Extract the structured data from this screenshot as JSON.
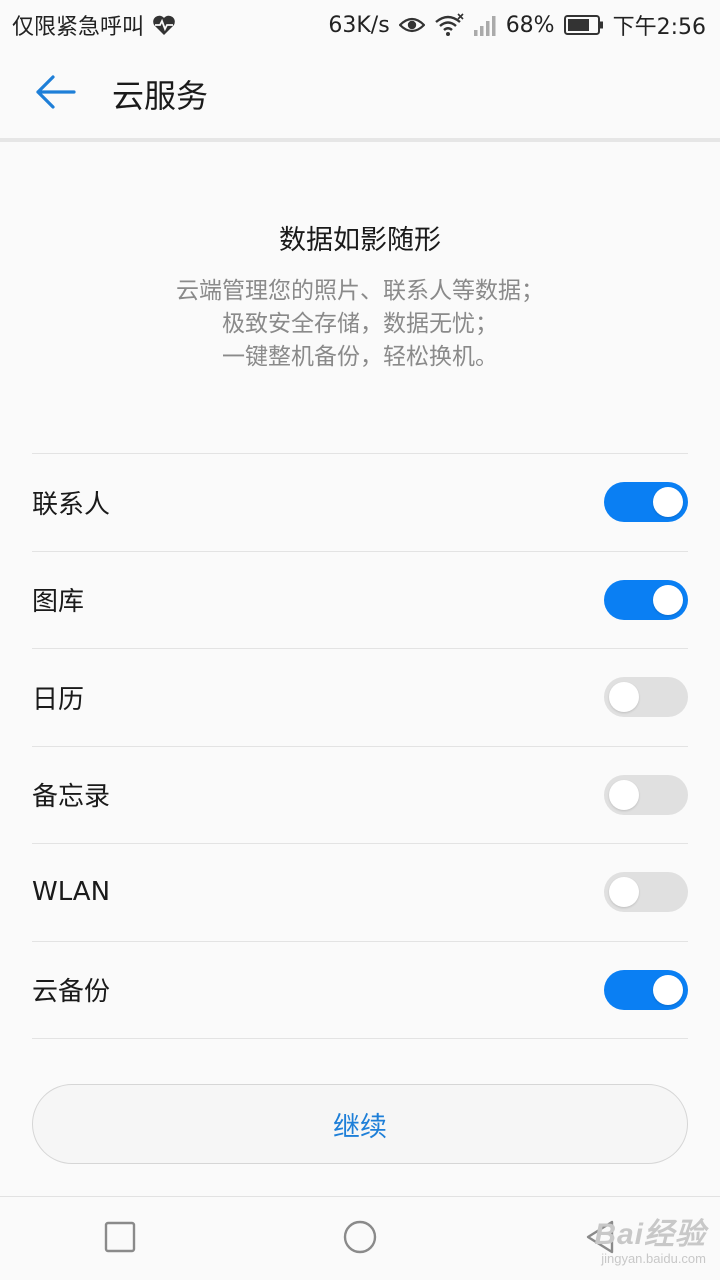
{
  "status_bar": {
    "carrier_text": "仅限紧急呼叫",
    "net_speed": "63K/s",
    "battery_percent": "68%",
    "time": "下午2:56",
    "icons": [
      "heart-rate-icon",
      "eye-icon",
      "wifi-icon",
      "signal-icon",
      "battery-icon"
    ]
  },
  "header": {
    "title": "云服务",
    "back_icon": "back-arrow-icon",
    "accent_color": "#1e7fd8"
  },
  "intro": {
    "heading": "数据如影随形",
    "lines": [
      "云端管理您的照片、联系人等数据；",
      "极致安全存储，数据无忧；",
      "一键整机备份，轻松换机。"
    ]
  },
  "sync_items": [
    {
      "label": "联系人",
      "enabled": true
    },
    {
      "label": "图库",
      "enabled": true
    },
    {
      "label": "日历",
      "enabled": false
    },
    {
      "label": "备忘录",
      "enabled": false
    },
    {
      "label": "WLAN",
      "enabled": false
    },
    {
      "label": "云备份",
      "enabled": true
    }
  ],
  "toggle_on_color": "#0a7ff3",
  "toggle_off_color": "#e0e0e0",
  "continue_button": {
    "label": "继续"
  },
  "nav_bar": {
    "icons": [
      "recent-apps-icon",
      "home-icon",
      "back-icon"
    ]
  },
  "watermark": {
    "main": "Bai经验",
    "sub": "jingyan.baidu.com"
  }
}
